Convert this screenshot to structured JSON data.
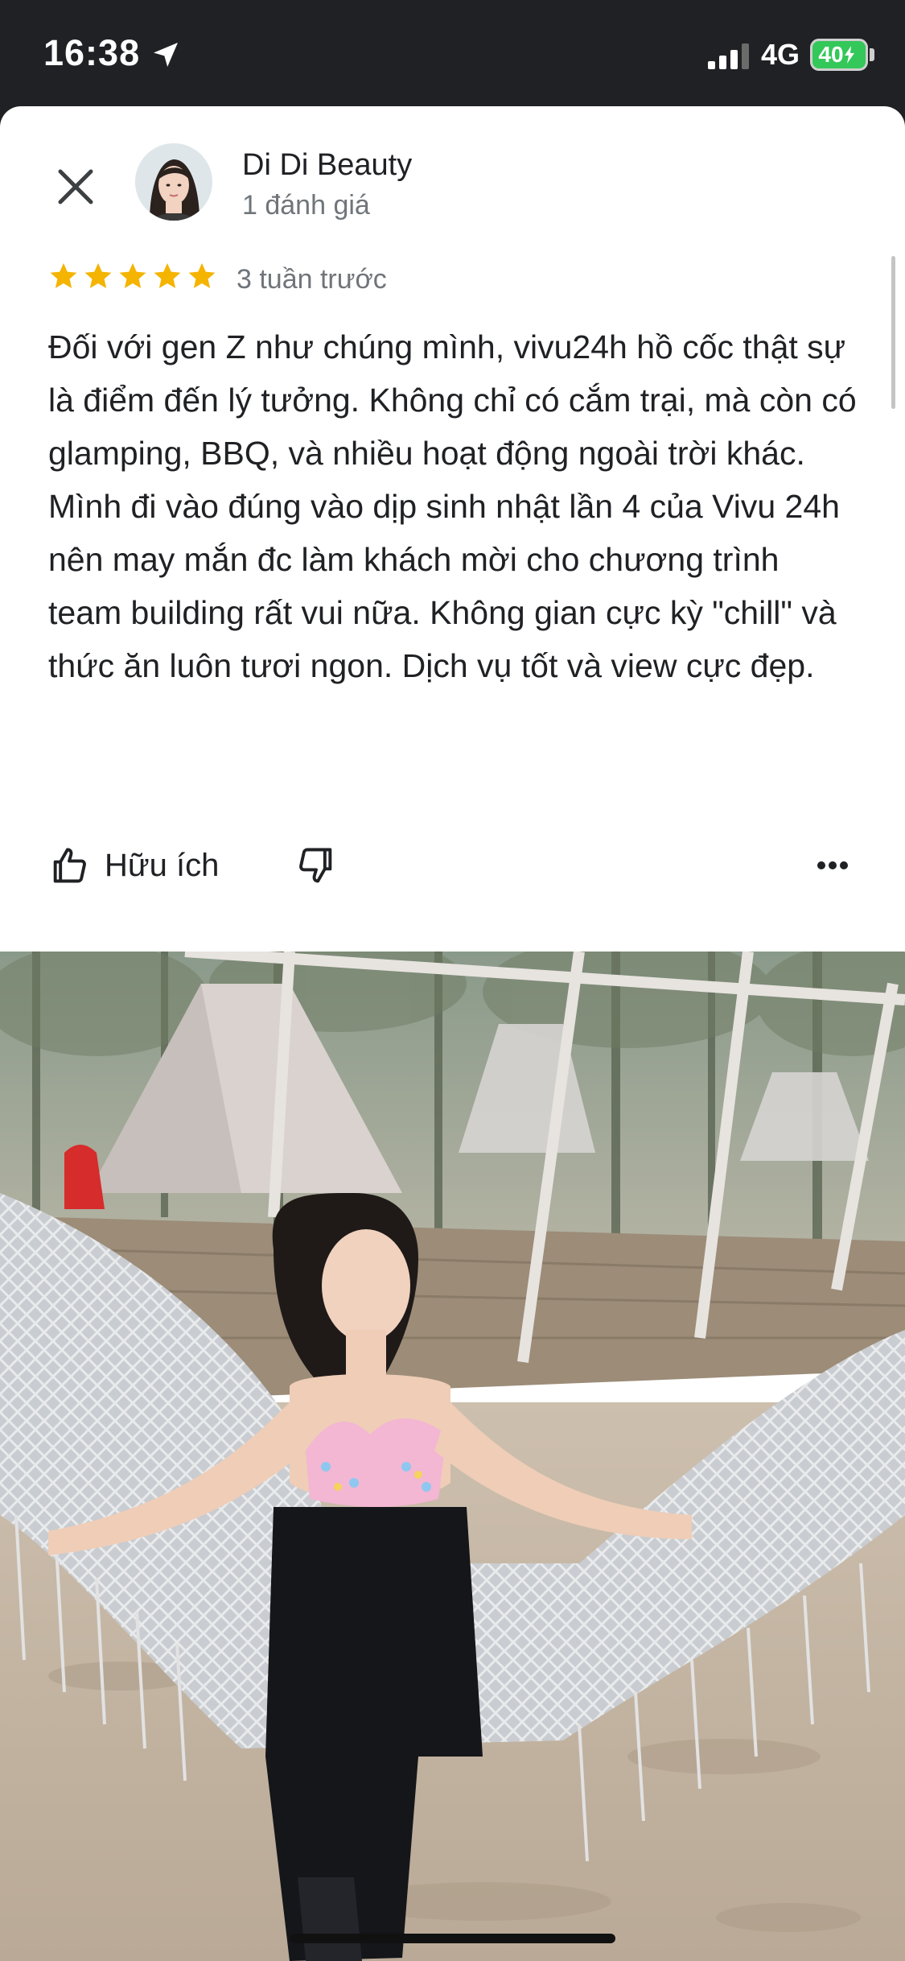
{
  "status_bar": {
    "time": "16:38",
    "network": "4G",
    "battery": "40"
  },
  "reviewer": {
    "name": "Di Di Beauty",
    "review_count": "1 đánh giá"
  },
  "review": {
    "rating": 5,
    "rating_max": 5,
    "time_ago": "3 tuần trước",
    "text": "Đối với gen Z như chúng mình, vivu24h hồ cốc thật sự là điểm đến lý tưởng. Không chỉ có cắm trại, mà còn có glamping, BBQ, và nhiều hoạt động ngoài trời khác. Mình đi vào đúng vào dịp sinh nhật lần 4 của Vivu 24h nên may mắn đc làm khách mời cho chương trình team building rất vui nữa. Không gian cực kỳ \"chill\" và thức ăn luôn tươi ngon. Dịch vụ tốt và view cực đẹp."
  },
  "actions": {
    "helpful_label": "Hữu ích"
  },
  "colors": {
    "star": "#f4b400",
    "text": "#202124",
    "secondary": "#70757a",
    "status_bg": "#202124",
    "battery": "#34c759"
  },
  "icons": [
    "location-arrow-icon",
    "signal-icon",
    "close-icon",
    "star-icon",
    "thumbs-up-icon",
    "thumbs-down-icon",
    "more-icon"
  ]
}
